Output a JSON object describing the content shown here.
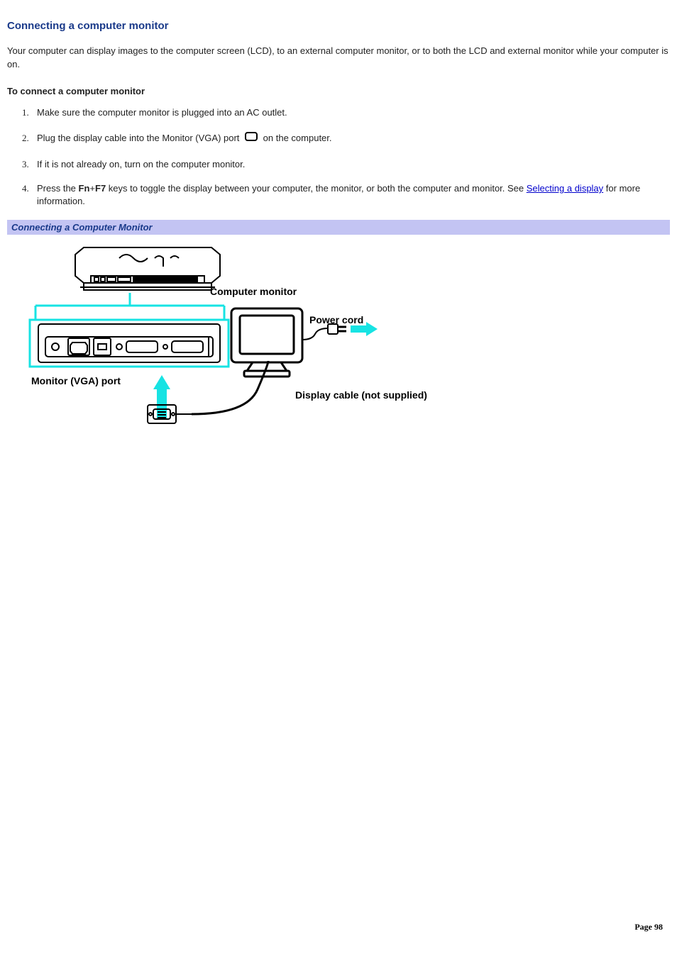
{
  "title": "Connecting a computer monitor",
  "intro": "Your computer can display images to the computer screen (LCD), to an external computer monitor, or to both the LCD and external monitor while your computer is on.",
  "subheading": "To connect a computer monitor",
  "steps": {
    "s1": "Make sure the computer monitor is plugged into an AC outlet.",
    "s2_a": "Plug the display cable into the Monitor (VGA) port ",
    "s2_b": " on the computer.",
    "s3": "If it is not already on, turn on the computer monitor.",
    "s4_a": "Press the ",
    "s4_key1": "Fn",
    "s4_plus": "+",
    "s4_key2": "F7",
    "s4_b": " keys to toggle the display between your computer, the monitor, or both the computer and monitor. See ",
    "s4_link": "Selecting a display",
    "s4_c": " for more information."
  },
  "caption": "Connecting a Computer Monitor",
  "figure": {
    "label_monitor": "Computer monitor",
    "label_power": "Power cord",
    "label_vga": "Monitor (VGA) port",
    "label_cable": "Display cable (not supplied)"
  },
  "footer": "Page 98"
}
